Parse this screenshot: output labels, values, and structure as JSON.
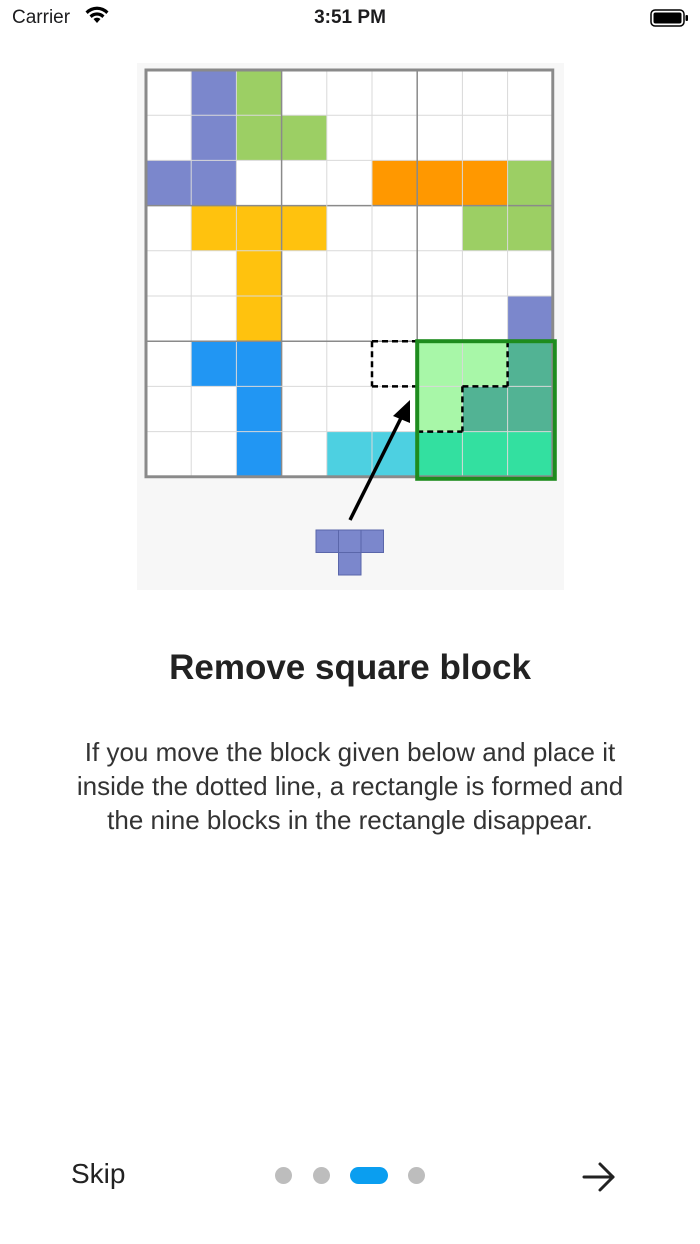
{
  "status_bar": {
    "carrier": "Carrier",
    "time": "3:51 PM"
  },
  "tutorial": {
    "title": "Remove square block",
    "description": "If you move the block given below and place it inside the dotted line, a rectangle is formed and the nine blocks in the rectangle disappear.",
    "grid": {
      "size": 9,
      "cells": [
        {
          "row": 0,
          "col": 1,
          "color": "#7b87cc"
        },
        {
          "row": 0,
          "col": 2,
          "color": "#9ccf64"
        },
        {
          "row": 1,
          "col": 1,
          "color": "#7b87cc"
        },
        {
          "row": 1,
          "col": 2,
          "color": "#9ccf64"
        },
        {
          "row": 1,
          "col": 3,
          "color": "#9ccf64"
        },
        {
          "row": 2,
          "col": 0,
          "color": "#7b87cc"
        },
        {
          "row": 2,
          "col": 1,
          "color": "#7b87cc"
        },
        {
          "row": 2,
          "col": 5,
          "color": "#ff9800"
        },
        {
          "row": 2,
          "col": 6,
          "color": "#ff9800"
        },
        {
          "row": 2,
          "col": 7,
          "color": "#ff9800"
        },
        {
          "row": 2,
          "col": 8,
          "color": "#9ccf64"
        },
        {
          "row": 3,
          "col": 1,
          "color": "#ffc20e"
        },
        {
          "row": 3,
          "col": 2,
          "color": "#ffc20e"
        },
        {
          "row": 3,
          "col": 3,
          "color": "#ffc20e"
        },
        {
          "row": 3,
          "col": 7,
          "color": "#9ccf64"
        },
        {
          "row": 3,
          "col": 8,
          "color": "#9ccf64"
        },
        {
          "row": 4,
          "col": 2,
          "color": "#ffc20e"
        },
        {
          "row": 5,
          "col": 2,
          "color": "#ffc20e"
        },
        {
          "row": 5,
          "col": 8,
          "color": "#7b87cc"
        },
        {
          "row": 6,
          "col": 1,
          "color": "#2196f3"
        },
        {
          "row": 6,
          "col": 2,
          "color": "#2196f3"
        },
        {
          "row": 6,
          "col": 6,
          "color": "#a8f7a8"
        },
        {
          "row": 6,
          "col": 7,
          "color": "#a8f7a8"
        },
        {
          "row": 6,
          "col": 8,
          "color": "#52b394"
        },
        {
          "row": 7,
          "col": 2,
          "color": "#2196f3"
        },
        {
          "row": 7,
          "col": 6,
          "color": "#a8f7a8"
        },
        {
          "row": 7,
          "col": 7,
          "color": "#52b394"
        },
        {
          "row": 7,
          "col": 8,
          "color": "#52b394"
        },
        {
          "row": 8,
          "col": 2,
          "color": "#2196f3"
        },
        {
          "row": 8,
          "col": 4,
          "color": "#4dd0e1"
        },
        {
          "row": 8,
          "col": 5,
          "color": "#4dd0e1"
        },
        {
          "row": 8,
          "col": 6,
          "color": "#33e0a0"
        },
        {
          "row": 8,
          "col": 7,
          "color": "#33e0a0"
        },
        {
          "row": 8,
          "col": 8,
          "color": "#33e0a0"
        }
      ],
      "dotted_target": [
        [
          6,
          5
        ],
        [
          6,
          6
        ],
        [
          6,
          7
        ],
        [
          7,
          6
        ]
      ],
      "highlight_rect": {
        "row": 6,
        "col": 6,
        "rows": 3,
        "cols": 3,
        "color": "#1e8c1e"
      }
    },
    "piece": {
      "color": "#7b87cc",
      "cells": [
        [
          0,
          0
        ],
        [
          0,
          1
        ],
        [
          0,
          2
        ],
        [
          1,
          1
        ]
      ]
    }
  },
  "navigation": {
    "skip_label": "Skip",
    "page_count": 4,
    "current_page": 3,
    "next_icon": "arrow-right-icon",
    "active_dot_color": "#0a9ef0",
    "inactive_dot_color": "#bdbdbd"
  }
}
